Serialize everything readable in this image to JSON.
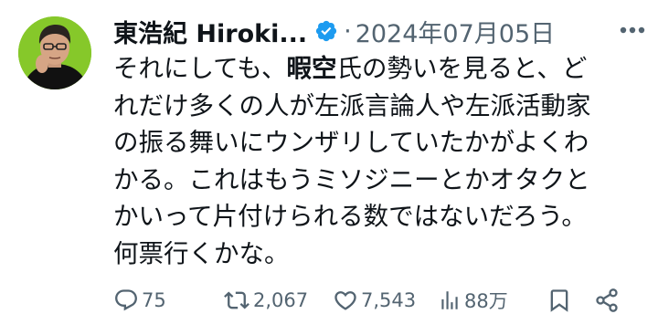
{
  "author": {
    "display_name": "東浩紀 Hiroki...",
    "separator": "·",
    "date": "2024年07月05日",
    "verified_badge_color": "#1d9bf0"
  },
  "tweet": {
    "lines": [
      {
        "pre": "それにしても、",
        "bold": "暇空",
        "post": "氏の勢いを見ると、ど"
      },
      {
        "pre": "れだけ多くの人が左派言論人や左派活動家",
        "bold": "",
        "post": ""
      },
      {
        "pre": "の振る舞いにウンザリしていたかがよくわ",
        "bold": "",
        "post": ""
      },
      {
        "pre": "かる。これはもうミソジニーとかオタクと",
        "bold": "",
        "post": ""
      },
      {
        "pre": "かいって片付けられる数ではないだろう。",
        "bold": "",
        "post": ""
      },
      {
        "pre": "何票行くかな。",
        "bold": "",
        "post": ""
      }
    ]
  },
  "actions": {
    "replies": "75",
    "reposts": "2,067",
    "likes": "7,543",
    "views": "88万"
  },
  "icons": {
    "more": "more-icon",
    "reply": "reply-icon",
    "repost": "repost-icon",
    "like": "heart-icon",
    "views": "views-icon",
    "bookmark": "bookmark-icon",
    "share": "share-icon"
  },
  "colors": {
    "text": "#0f1419",
    "secondary": "#536471",
    "avatar_bg": "#86c82a"
  }
}
